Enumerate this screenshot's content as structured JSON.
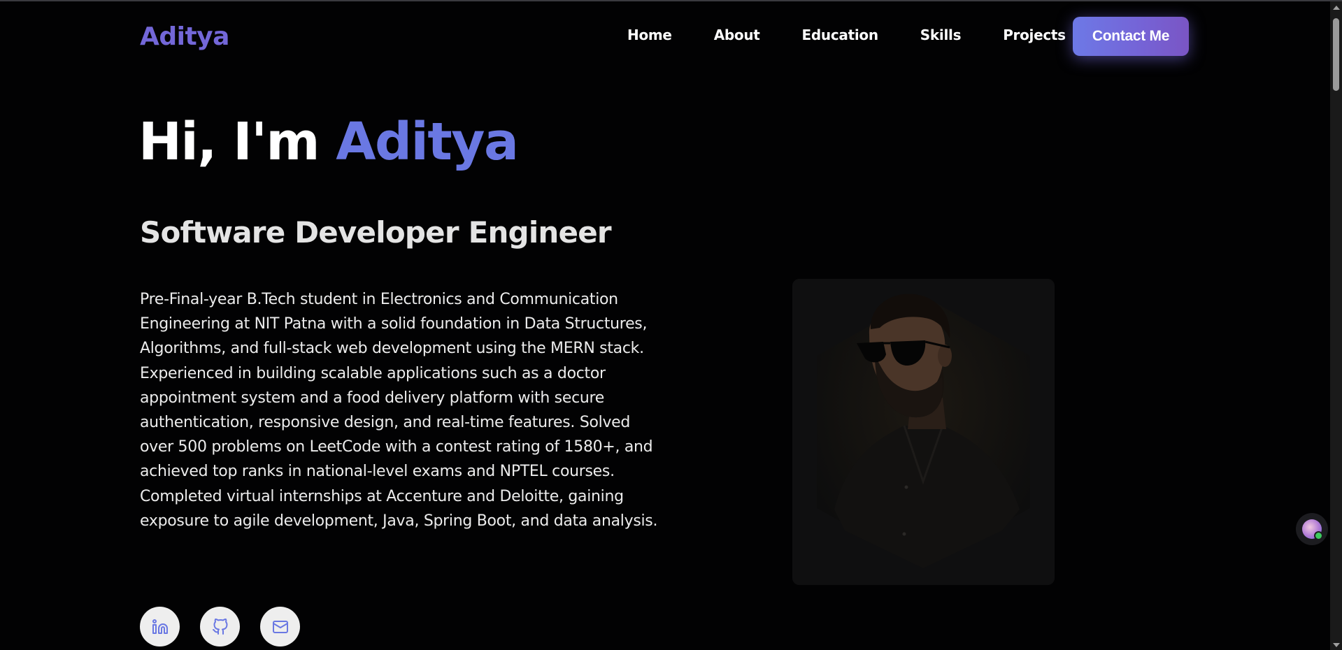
{
  "nav": {
    "logo": "Aditya",
    "items": [
      "Home",
      "About",
      "Education",
      "Skills",
      "Projects"
    ],
    "contact_label": "Contact Me"
  },
  "hero": {
    "greeting": "Hi, I'm ",
    "name": "Aditya",
    "subtitle": "Software Developer Engineer",
    "bio": "Pre-Final-year B.Tech student in Electronics and Communication Engineering at NIT Patna with a solid foundation in Data Structures, Algorithms, and full-stack web development using the MERN stack. Experienced in building scalable applications such as a doctor appointment system and a food delivery platform with secure authentication, responsive design, and real-time features. Solved over 500 problems on LeetCode with a contest rating of 1580+, and achieved top ranks in national-level exams and NPTEL courses. Completed virtual internships at Accenture and Deloitte, gaining exposure to agile development, Java, Spring Boot, and data analysis."
  },
  "socials": [
    {
      "icon": "linkedin-icon"
    },
    {
      "icon": "github-icon"
    },
    {
      "icon": "mail-icon"
    }
  ],
  "colors": {
    "accent": "#6a78e3",
    "logo": "#7367d8",
    "background": "#020203"
  }
}
